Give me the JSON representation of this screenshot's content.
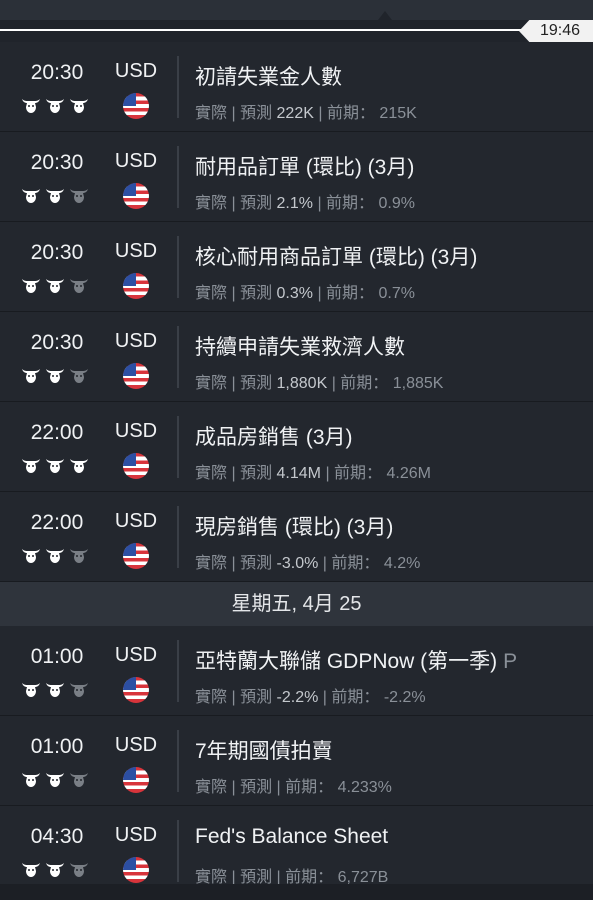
{
  "clock": "19:46",
  "day_header_1": "星期五, 4月 25",
  "labels": {
    "actual": "實際",
    "forecast": "預測",
    "previous": "前期："
  },
  "colors": {
    "bull_active": "#ffffff",
    "bull_inactive": "#7a7f86"
  },
  "section1": [
    {
      "time": "20:30",
      "currency": "USD",
      "title": "初請失業金人數",
      "forecast": "222K",
      "previous": "215K",
      "impact": 3
    },
    {
      "time": "20:30",
      "currency": "USD",
      "title": "耐用品訂單 (環比) (3月)",
      "forecast": "2.1%",
      "previous": "0.9%",
      "impact": 2
    },
    {
      "time": "20:30",
      "currency": "USD",
      "title": "核心耐用商品訂單 (環比) (3月)",
      "forecast": "0.3%",
      "previous": "0.7%",
      "impact": 2
    },
    {
      "time": "20:30",
      "currency": "USD",
      "title": "持續申請失業救濟人數",
      "forecast": "1,880K",
      "previous": "1,885K",
      "impact": 2
    },
    {
      "time": "22:00",
      "currency": "USD",
      "title": "成品房銷售 (3月)",
      "forecast": "4.14M",
      "previous": "4.26M",
      "impact": 3
    },
    {
      "time": "22:00",
      "currency": "USD",
      "title": "現房銷售 (環比) (3月)",
      "forecast": "-3.0%",
      "previous": "4.2%",
      "impact": 2
    }
  ],
  "section2": [
    {
      "time": "01:00",
      "currency": "USD",
      "title": "亞特蘭大聯儲 GDPNow (第一季)",
      "suffix": "P",
      "forecast": "-2.2%",
      "previous": "-2.2%",
      "impact": 2
    },
    {
      "time": "01:00",
      "currency": "USD",
      "title": "7年期國債拍賣",
      "forecast": "",
      "previous": "4.233%",
      "impact": 2
    },
    {
      "time": "04:30",
      "currency": "USD",
      "title": "Fed's Balance Sheet",
      "forecast": "",
      "previous": "6,727B",
      "impact": 2
    }
  ]
}
